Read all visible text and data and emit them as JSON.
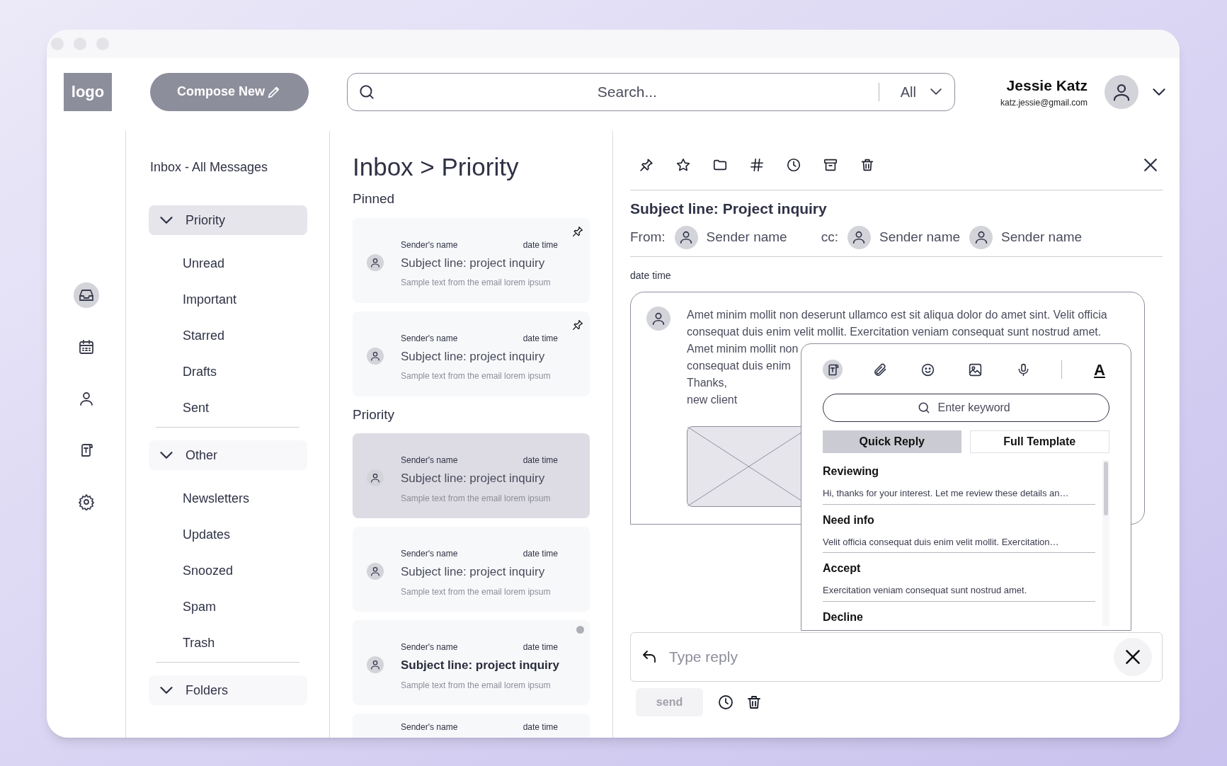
{
  "header": {
    "logo": "logo",
    "compose_button": "Compose New",
    "search": {
      "placeholder": "Search...",
      "filter": "All"
    },
    "user": {
      "name": "Jessie Katz",
      "email": "katz.jessie@gmail.com"
    }
  },
  "rail": [
    {
      "kind": "inbox",
      "selected": true
    },
    {
      "kind": "calendar",
      "selected": false
    },
    {
      "kind": "contacts",
      "selected": false
    },
    {
      "kind": "templates",
      "selected": false
    },
    {
      "kind": "settings",
      "selected": false
    }
  ],
  "nav": {
    "title": "Inbox - All Messages",
    "groups": [
      {
        "label": "Priority",
        "selected": true,
        "children": [
          {
            "label": "Unread"
          },
          {
            "label": "Important"
          },
          {
            "label": "Starred"
          },
          {
            "label": "Drafts"
          },
          {
            "label": "Sent"
          }
        ]
      },
      {
        "label": "Other",
        "selected": false,
        "children": [
          {
            "label": "Newsletters"
          },
          {
            "label": "Updates"
          },
          {
            "label": "Snoozed"
          },
          {
            "label": "Spam"
          },
          {
            "label": "Trash"
          }
        ]
      },
      {
        "label": "Folders",
        "selected": false
      }
    ]
  },
  "list": {
    "title": "Inbox > Priority",
    "sections": [
      {
        "title": "Pinned",
        "messages": [
          {
            "sender": "Sender's name",
            "date": "date time",
            "subject": "Subject line: project inquiry",
            "snippet": "Sample text from the email lorem ipsum",
            "pinned": true,
            "selected": false,
            "unread": false
          },
          {
            "sender": "Sender's name",
            "date": "date time",
            "subject": "Subject line: project inquiry",
            "snippet": "Sample text from the email lorem ipsum",
            "pinned": true,
            "selected": false,
            "unread": false
          }
        ]
      },
      {
        "title": "Priority",
        "messages": [
          {
            "sender": "Sender's name",
            "date": "date time",
            "subject": "Subject line: project inquiry",
            "snippet": "Sample text from the email lorem ipsum",
            "pinned": false,
            "selected": true,
            "unread": false
          },
          {
            "sender": "Sender's name",
            "date": "date time",
            "subject": "Subject line: project inquiry",
            "snippet": "Sample text from the email lorem ipsum",
            "pinned": false,
            "selected": false,
            "unread": false
          },
          {
            "sender": "Sender's name",
            "date": "date time",
            "subject": "Subject line: project inquiry",
            "snippet": "Sample text from the email lorem ipsum",
            "pinned": false,
            "selected": false,
            "unread": true
          },
          {
            "sender": "Sender's name",
            "date": "date time",
            "pinned": false,
            "selected": false
          }
        ]
      }
    ]
  },
  "message": {
    "toolbar": [
      {
        "kind": "pin"
      },
      {
        "kind": "star"
      },
      {
        "kind": "folder"
      },
      {
        "kind": "tag"
      },
      {
        "kind": "snooze"
      },
      {
        "kind": "archive"
      },
      {
        "kind": "delete"
      }
    ],
    "subject": "Subject line: Project inquiry",
    "from_label": "From:",
    "from": [
      "Sender name"
    ],
    "cc_label": "cc:",
    "cc": [
      "Sender name",
      "Sender name"
    ],
    "date": "date time",
    "body": [
      "Amet minim mollit non deserunt ullamco est sit aliqua dolor do amet sint. Velit officia consequat duis enim velit mollit. Exercitation veniam consequat sunt nostrud amet.",
      "Amet minim mollit non",
      "consequat duis enim",
      "Thanks,",
      "new client"
    ]
  },
  "templates_popup": {
    "tools": [
      {
        "kind": "template",
        "selected": true
      },
      {
        "kind": "attach",
        "selected": false
      },
      {
        "kind": "emoji",
        "selected": false
      },
      {
        "kind": "image",
        "selected": false
      },
      {
        "kind": "voice",
        "selected": false
      },
      {
        "kind": "format",
        "label": "A",
        "selected": false
      }
    ],
    "search_placeholder": "Enter keyword",
    "tabs": [
      {
        "label": "Quick Reply",
        "selected": true
      },
      {
        "label": "Full Template",
        "selected": false
      }
    ],
    "items": [
      {
        "title": "Reviewing",
        "text": "Hi, thanks for your interest. Let me review these details an…"
      },
      {
        "title": "Need info",
        "text": "Velit officia consequat duis enim velit mollit. Exercitation…"
      },
      {
        "title": "Accept",
        "text": "Exercitation veniam consequat sunt nostrud amet."
      },
      {
        "title": "Decline"
      }
    ]
  },
  "reply": {
    "placeholder": "Type reply",
    "send": "send"
  }
}
